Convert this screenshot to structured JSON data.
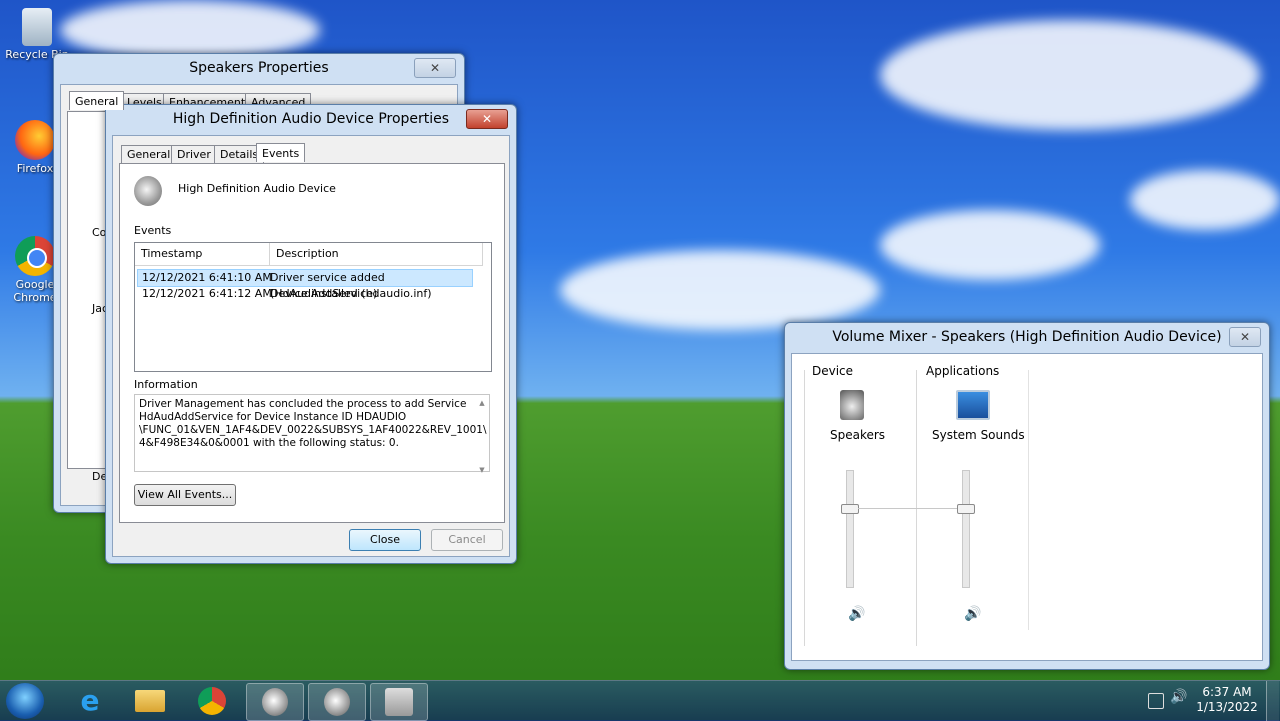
{
  "desktop": {
    "icons": [
      {
        "label": "Recycle Bin"
      },
      {
        "label": "Firefox"
      },
      {
        "label": "Google Chrome"
      }
    ]
  },
  "speakers_props": {
    "title": "Speakers Properties",
    "close": "✕",
    "tabs": [
      "General",
      "Levels",
      "Enhancements",
      "Advanced"
    ],
    "side_labels": [
      "Co",
      "Jac",
      "Dev"
    ]
  },
  "hd_props": {
    "title": "High Definition Audio Device Properties",
    "close": "✕",
    "tabs": [
      "General",
      "Driver",
      "Details",
      "Events"
    ],
    "device_name": "High Definition Audio Device",
    "events_label": "Events",
    "columns": [
      "Timestamp",
      "Description"
    ],
    "rows": [
      {
        "timestamp": "12/12/2021 6:41:10 AM",
        "description": "Driver service added (HdAudAddService)"
      },
      {
        "timestamp": "12/12/2021 6:41:12 AM",
        "description": "Device installed (hdaudio.inf)"
      }
    ],
    "information_label": "Information",
    "information_lines": [
      "Driver Management has concluded the process to add Service",
      "HdAudAddService for Device Instance ID HDAUDIO",
      "\\FUNC_01&VEN_1AF4&DEV_0022&SUBSYS_1AF40022&REV_1001\\",
      "4&F498E34&0&0001 with the following status: 0."
    ],
    "view_all_events": "View All Events...",
    "close_button": "Close",
    "cancel_button": "Cancel"
  },
  "mixer": {
    "title": "Volume Mixer - Speakers (High Definition Audio Device)",
    "close": "✕",
    "device_label": "Device",
    "applications_label": "Applications",
    "channels": [
      {
        "name": "Speakers",
        "level": 0.72
      },
      {
        "name": "System Sounds",
        "level": 0.72
      }
    ]
  },
  "taskbar": {
    "time": "6:37 AM",
    "date": "1/13/2022"
  },
  "colors": {
    "selection": "#cce8ff",
    "default_button_border": "#3c7fb1"
  }
}
